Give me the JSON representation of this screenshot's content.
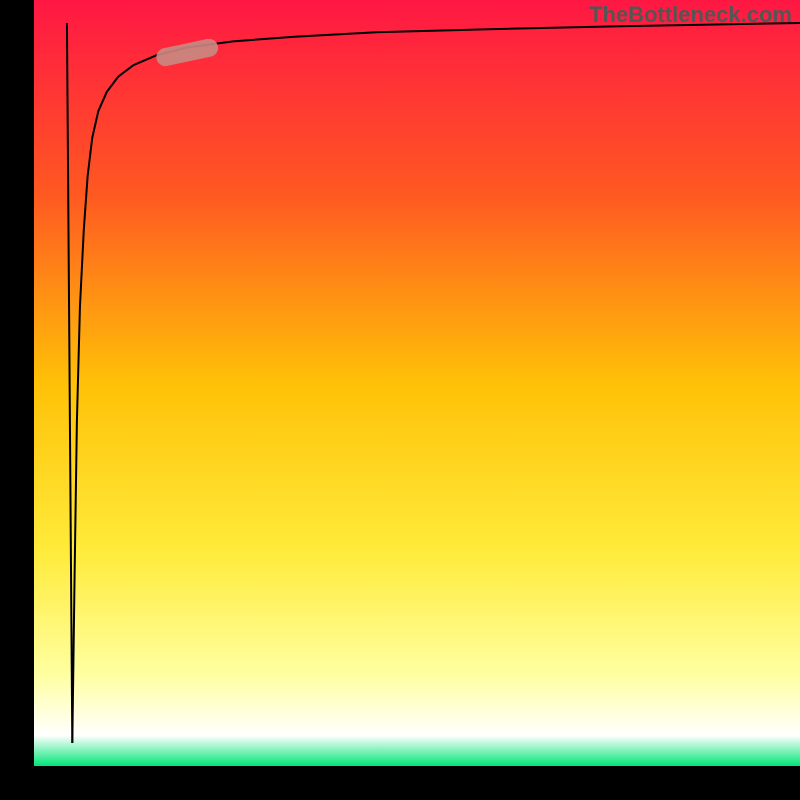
{
  "watermark": "TheBottleneck.com",
  "chart_data": {
    "type": "line",
    "title": "",
    "xlabel": "",
    "ylabel": "",
    "xlim": [
      0,
      100
    ],
    "ylim": [
      0,
      100
    ],
    "background_gradient": {
      "stops": [
        {
          "pos": 0.0,
          "color": "#ff1744"
        },
        {
          "pos": 0.25,
          "color": "#ff5722"
        },
        {
          "pos": 0.5,
          "color": "#ffc107"
        },
        {
          "pos": 0.72,
          "color": "#ffeb3b"
        },
        {
          "pos": 0.88,
          "color": "#ffffa0"
        },
        {
          "pos": 0.96,
          "color": "#ffffff"
        },
        {
          "pos": 1.0,
          "color": "#00e676"
        }
      ]
    },
    "frame": {
      "color": "#000000",
      "left_width": 34,
      "bottom_height": 34
    },
    "series": [
      {
        "name": "bottleneck-curve",
        "color": "#000000",
        "stroke_width": 2,
        "x": [
          5.0,
          5.3,
          5.6,
          6.0,
          6.5,
          7.0,
          7.6,
          8.4,
          9.5,
          11,
          13,
          16,
          20,
          26,
          34,
          45,
          60,
          78,
          100
        ],
        "y": [
          3,
          25,
          45,
          60,
          70,
          77,
          82,
          85.5,
          88,
          90,
          91.5,
          92.8,
          93.8,
          94.6,
          95.2,
          95.8,
          96.2,
          96.6,
          97
        ]
      },
      {
        "name": "initial-drop",
        "color": "#000000",
        "stroke_width": 2,
        "x": [
          4.3,
          5.0
        ],
        "y": [
          97,
          3
        ]
      }
    ],
    "marker": {
      "name": "highlight-segment",
      "color": "#c98a83",
      "opacity": 0.9,
      "x_range": [
        16,
        24
      ],
      "y_range": [
        92.3,
        94
      ],
      "thickness": 18
    }
  }
}
